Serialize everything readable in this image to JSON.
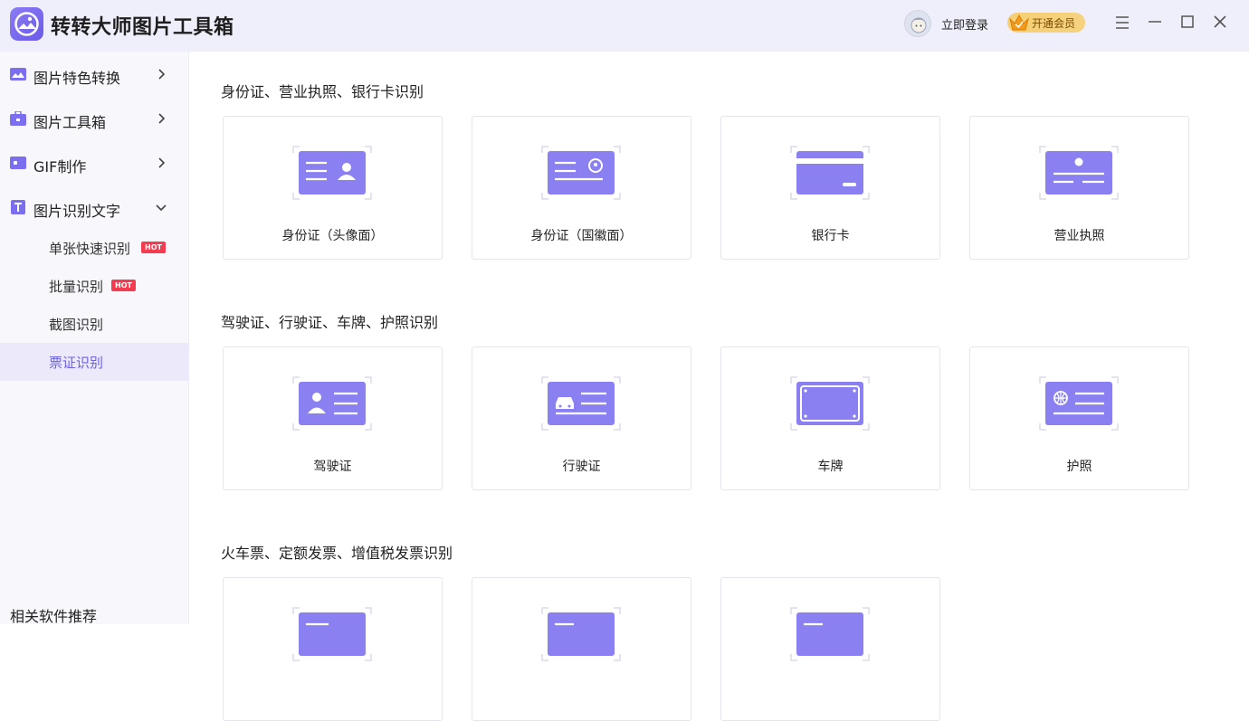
{
  "app": {
    "title": "转转大师图片工具箱",
    "login_label": "立即登录",
    "vip_label": "开通会员",
    "accent": "#7b6ff0"
  },
  "sidebar": {
    "items": [
      {
        "label": "图片特色转换",
        "icon": "image-convert-icon",
        "expanded": false
      },
      {
        "label": "图片工具箱",
        "icon": "toolbox-icon",
        "expanded": false
      },
      {
        "label": "GIF制作",
        "icon": "gif-icon",
        "expanded": false
      },
      {
        "label": "图片识别文字",
        "icon": "text-recognition-icon",
        "expanded": true
      }
    ],
    "subitems": [
      {
        "label": "单张快速识别",
        "badge": "HOT"
      },
      {
        "label": "批量识别",
        "badge": "HOT"
      },
      {
        "label": "截图识别",
        "badge": ""
      },
      {
        "label": "票证识别",
        "badge": "",
        "active": true
      }
    ],
    "related": "相关软件推荐"
  },
  "sections": [
    {
      "title": "身份证、营业执照、银行卡识别",
      "cards": [
        {
          "label": "身份证（头像面）",
          "icon": "id-card-front-icon"
        },
        {
          "label": "身份证（国徽面）",
          "icon": "id-card-back-icon"
        },
        {
          "label": "银行卡",
          "icon": "bank-card-icon"
        },
        {
          "label": "营业执照",
          "icon": "business-license-icon"
        }
      ]
    },
    {
      "title": "驾驶证、行驶证、车牌、护照识别",
      "cards": [
        {
          "label": "驾驶证",
          "icon": "driver-license-icon"
        },
        {
          "label": "行驶证",
          "icon": "vehicle-license-icon"
        },
        {
          "label": "车牌",
          "icon": "license-plate-icon"
        },
        {
          "label": "护照",
          "icon": "passport-icon"
        }
      ]
    },
    {
      "title": "火车票、定额发票、增值税发票识别",
      "cards": [
        {
          "label": "",
          "icon": "train-ticket-icon"
        },
        {
          "label": "",
          "icon": "quota-invoice-icon"
        },
        {
          "label": "",
          "icon": "vat-invoice-icon"
        }
      ]
    }
  ]
}
